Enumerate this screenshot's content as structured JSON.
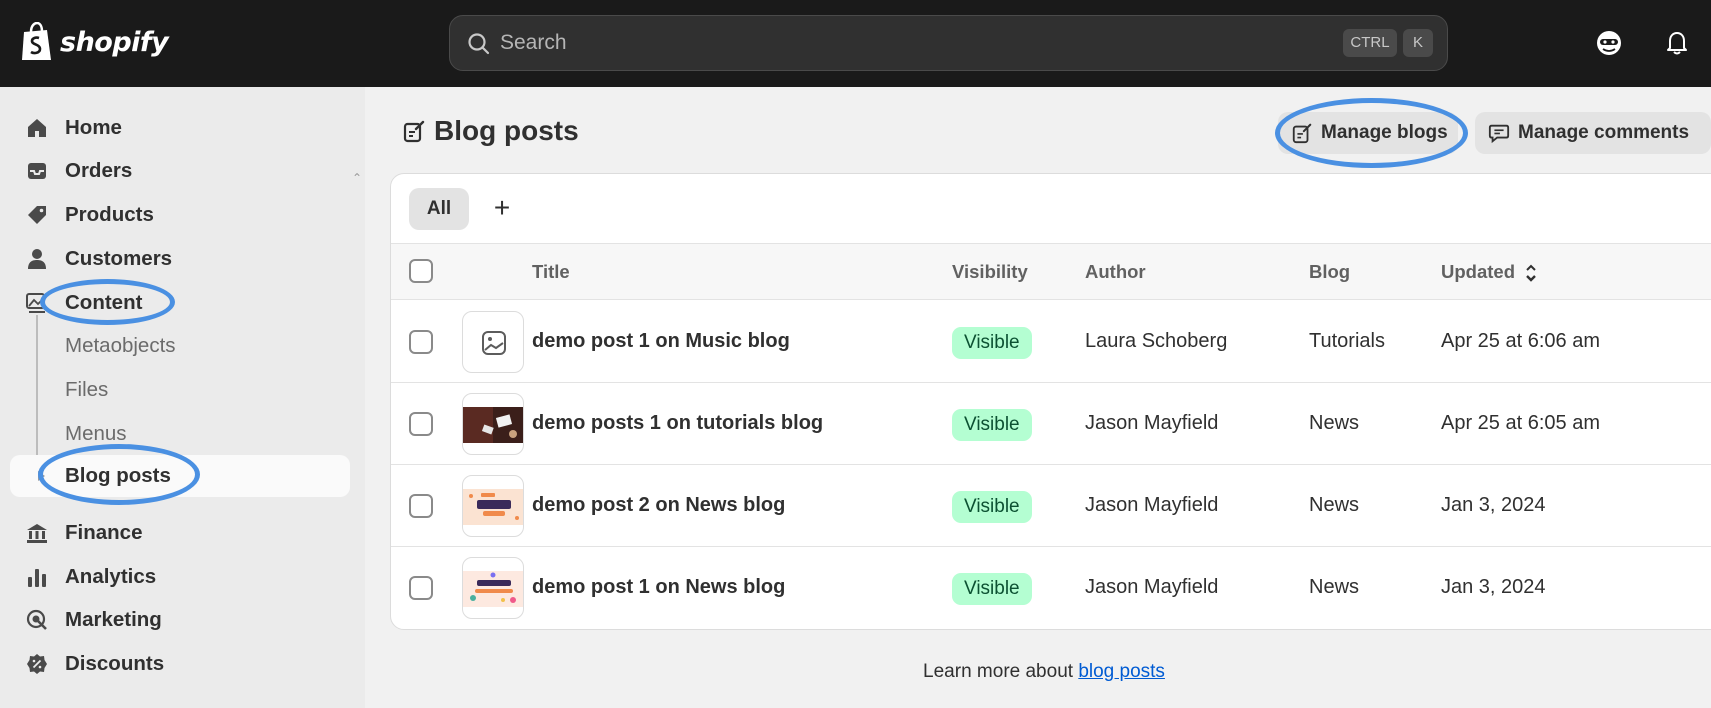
{
  "brand": {
    "name": "shopify"
  },
  "search": {
    "placeholder": "Search",
    "shortcut_ctrl": "CTRL",
    "shortcut_key": "K"
  },
  "nav": {
    "home": "Home",
    "orders": "Orders",
    "products": "Products",
    "customers": "Customers",
    "content": "Content",
    "content_sub": [
      "Metaobjects",
      "Files",
      "Menus",
      "Blog posts"
    ],
    "finance": "Finance",
    "analytics": "Analytics",
    "marketing": "Marketing",
    "discounts": "Discounts"
  },
  "page": {
    "title": "Blog posts",
    "manage_blogs": "Manage blogs",
    "manage_comments": "Manage comments"
  },
  "tabs": {
    "all": "All",
    "add": "+"
  },
  "table": {
    "columns": {
      "title": "Title",
      "visibility": "Visibility",
      "author": "Author",
      "blog": "Blog",
      "updated": "Updated"
    },
    "rows": [
      {
        "title": "demo post 1 on Music blog",
        "visibility": "Visible",
        "author": "Laura Schoberg",
        "blog": "Tutorials",
        "updated": "Apr 25 at 6:06 am"
      },
      {
        "title": "demo posts 1 on tutorials blog",
        "visibility": "Visible",
        "author": "Jason Mayfield",
        "blog": "News",
        "updated": "Apr 25 at 6:05 am"
      },
      {
        "title": "demo post 2 on News blog",
        "visibility": "Visible",
        "author": "Jason Mayfield",
        "blog": "News",
        "updated": "Jan 3, 2024"
      },
      {
        "title": "demo post 1 on News blog",
        "visibility": "Visible",
        "author": "Jason Mayfield",
        "blog": "News",
        "updated": "Jan 3, 2024"
      }
    ]
  },
  "footer": {
    "prefix": "Learn more about ",
    "link": "blog posts"
  },
  "colors": {
    "topbar": "#1a1a1a",
    "sidebar": "#ebebeb",
    "badge_bg": "#b4fed2",
    "link": "#005bd3",
    "annotation": "#4a90e2"
  }
}
